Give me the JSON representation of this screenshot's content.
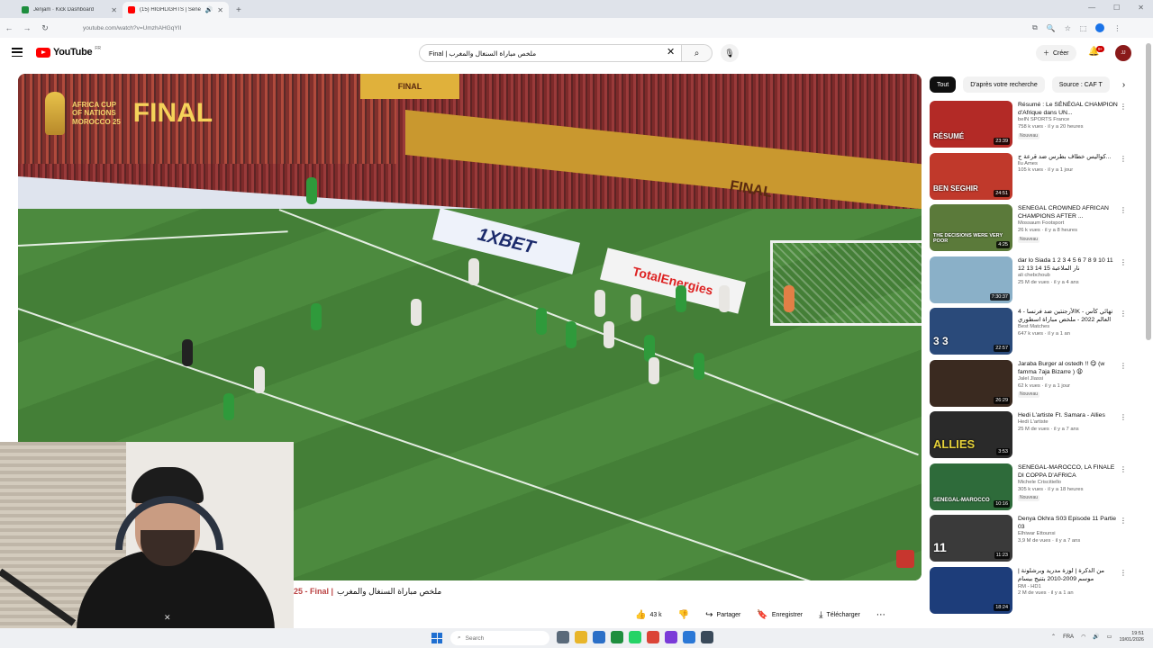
{
  "browser": {
    "tabs": [
      {
        "title": "Jenjam · Kick Dashboard",
        "active": false
      },
      {
        "title": "(15) HIGHLIGHTS | Senega",
        "active": true
      }
    ],
    "url": "youtube.com/watch?v=UmzhAHGqYII"
  },
  "youtube": {
    "logo": "YouTube",
    "country": "FR",
    "search_value": "Final | ملخص مباراة السنغال والمغرب",
    "create_label": "Créer",
    "notif_count": "9+",
    "avatar_label": "JJ"
  },
  "video": {
    "title_prefix": "25 - Final |",
    "title_rest": "ملخص مباراة السنغال والمغرب",
    "likes": "43 k",
    "share_label": "Partager",
    "save_label": "Enregistrer",
    "download_label": "Télécharger",
    "overlay": {
      "afcon_line1": "AFRICA CUP",
      "afcon_line2": "OF NATIONS",
      "afcon_line3": "MOROCCO 25",
      "afcon_final": "FINAL",
      "board_bet": "1XBET",
      "board_total": "TotalEnergies",
      "sign_final": "FINAL"
    }
  },
  "chips": [
    "Tout",
    "D'après votre recherche",
    "Source : CAF T"
  ],
  "recommendations": [
    {
      "title": "Résumé : Le SÉNÉGAL CHAMPION d'Afrique dans UN...",
      "channel": "beIN SPORTS France",
      "stats": "758 k vues · il y a 20 heures",
      "badge": "Nouveau",
      "duration": "23:39",
      "thumb_text": "RÉSUMÉ",
      "color": "#b32a26"
    },
    {
      "title": "كواليس خطاف بطرس ضد قرعة ج...",
      "channel": "llu Ames",
      "stats": "105 k vues · il y a 1 jour",
      "badge": "",
      "duration": "24:51",
      "thumb_text": "BEN SEGHIR",
      "color": "#c0392b"
    },
    {
      "title": "SENEGAL CROWNED AFRICAN CHAMPIONS AFTER ...",
      "channel": "Mossaum Footsport",
      "stats": "26 k vues · il y a 8 heures",
      "badge": "Nouveau",
      "duration": "4:25",
      "thumb_text": "THE DECISIONS WERE VERY POOR",
      "color": "#5b7a3a"
    },
    {
      "title": "dar lo Siada 1 2 3 4 5 6 7 8 9 10 11 12 13 14 15 نار الملاعبة",
      "channel": "ali chebchoub",
      "stats": "25 M de vues · il y a 4 ans",
      "badge": "",
      "duration": "7:30:37",
      "thumb_text": "",
      "color": "#8ab0c8"
    },
    {
      "title": "الأرجنتين ضد فرنسا - 4K - نهائي كأس العالم 2022 - ملخص مباراة اسطوري",
      "channel": "Best Matches",
      "stats": "647 k vues · il y a 1 an",
      "badge": "",
      "duration": "22:57",
      "thumb_text": "3  3",
      "color": "#2a4a7a"
    },
    {
      "title": "Jaraba Burger al ostedh !! 😋 (w famma 7aja Bizarre ) 😩",
      "channel": "Jalel Jlassi",
      "stats": "62 k vues · il y a 1 jour",
      "badge": "Nouveau",
      "duration": "26:29",
      "thumb_text": "",
      "color": "#3a2a20"
    },
    {
      "title": "Hedi L'artiste Ft. Samara - Allies",
      "channel": "Hedi L'artiste",
      "stats": "25 M de vues · il y a 7 ans",
      "badge": "",
      "duration": "3:53",
      "thumb_text": "ALLIES",
      "color": "#2a2a2a"
    },
    {
      "title": "SENEGAL-MAROCCO, LA FINALE DI COPPA D'AFRICA",
      "channel": "Michele Criscitiello",
      "stats": "305 k vues · il y a 18 heures",
      "badge": "Nouveau",
      "duration": "10:16",
      "thumb_text": "SENEGAL-MAROCCO",
      "color": "#2e6b3a"
    },
    {
      "title": "Denya Okhra S03 Episode 11 Partie 03",
      "channel": "Elhiwar Ettounsi",
      "stats": "3,9 M de vues · il y a 7 ans",
      "badge": "",
      "duration": "11:23",
      "thumb_text": "11",
      "color": "#3a3a3a"
    },
    {
      "title": "من الدكرة | لوزة مدريد وبرشلونة | موسم 2009-2010 بتنيج بيسام الليسبوني جونة",
      "channel": "RM - HD1",
      "stats": "2 M de vues · il y a 1 an",
      "badge": "",
      "duration": "18:24",
      "thumb_text": "",
      "color": "#1d3d7a"
    }
  ],
  "taskbar": {
    "search_placeholder": "Search",
    "time": "19:51",
    "date": "19/01/2026",
    "lang": "FRA"
  }
}
